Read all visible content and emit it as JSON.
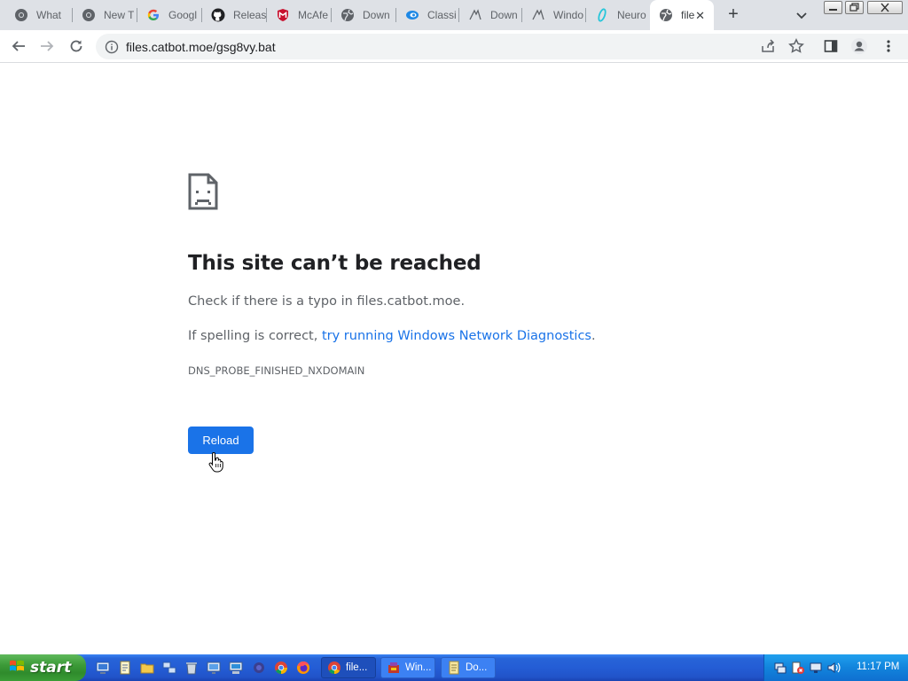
{
  "browser": {
    "tabs": [
      {
        "title": "What",
        "icon": "chrome-icon"
      },
      {
        "title": "New T",
        "icon": "chrome-icon"
      },
      {
        "title": "Googl",
        "icon": "google-icon"
      },
      {
        "title": "Releas",
        "icon": "github-icon"
      },
      {
        "title": "McAfe",
        "icon": "mcafee-icon"
      },
      {
        "title": "Down",
        "icon": "globe-icon"
      },
      {
        "title": "Classi",
        "icon": "classic-icon"
      },
      {
        "title": "Down",
        "icon": "download-icon"
      },
      {
        "title": "Windo",
        "icon": "download-icon"
      },
      {
        "title": "Neuro",
        "icon": "neuro-icon"
      },
      {
        "title": "file",
        "icon": "globe-icon",
        "active": true
      }
    ],
    "close_tab_label": "✕",
    "new_tab_label": "+",
    "url": "files.catbot.moe/gsg8vy.bat"
  },
  "error_page": {
    "title": "This site can’t be reached",
    "line1": "Check if there is a typo in files.catbot.moe.",
    "line2_prefix": "If spelling is correct, ",
    "line2_link": "try running Windows Network Diagnostics",
    "line2_suffix": ".",
    "code": "DNS_PROBE_FINISHED_NXDOMAIN",
    "reload_label": "Reload"
  },
  "taskbar": {
    "start_label": "start",
    "tasks": [
      {
        "label": "file...",
        "icon": "chrome-icon",
        "active": true
      },
      {
        "label": "Win...",
        "icon": "app-icon",
        "active": false
      },
      {
        "label": "Do...",
        "icon": "folder-icon",
        "active": false
      }
    ],
    "clock": "11:17 PM"
  },
  "colors": {
    "link": "#1a73e8",
    "button": "#1a73e8",
    "taskbar": "#245dd5",
    "start": "#3c9a38"
  }
}
